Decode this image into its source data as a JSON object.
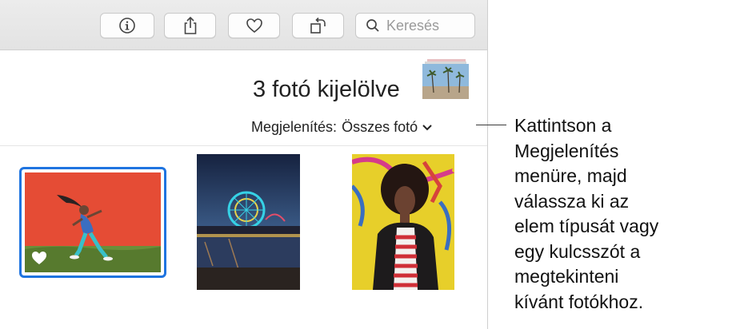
{
  "toolbar": {
    "buttons": [
      {
        "icon": "info-icon"
      },
      {
        "icon": "share-icon"
      },
      {
        "icon": "heart-icon"
      },
      {
        "icon": "rotate-icon"
      }
    ],
    "search": {
      "placeholder": "Keresés",
      "icon": "search-icon"
    }
  },
  "header": {
    "selection_title": "3 fotó kijelölve"
  },
  "view_menu": {
    "label": "Megjelenítés:",
    "value": "Összes fotó",
    "icon": "chevron-down-icon"
  },
  "photos": [
    {
      "subject": "dancer-on-red-wall",
      "selected": true,
      "favorite": true
    },
    {
      "subject": "ferris-wheel-pier-night",
      "selected": false,
      "favorite": false
    },
    {
      "subject": "woman-yellow-graffiti",
      "selected": false,
      "favorite": false
    }
  ],
  "callout": {
    "text_lines": [
      "Kattintson a",
      "Megjelenítés",
      "menüre, majd",
      "válassza ki az",
      "elem típusát vagy",
      "egy kulcsszót a",
      "megtekinteni",
      "kívánt fotókhoz."
    ]
  },
  "colors": {
    "selection": "#1f74e0",
    "toolbar_bg": "#e6e6e6"
  }
}
